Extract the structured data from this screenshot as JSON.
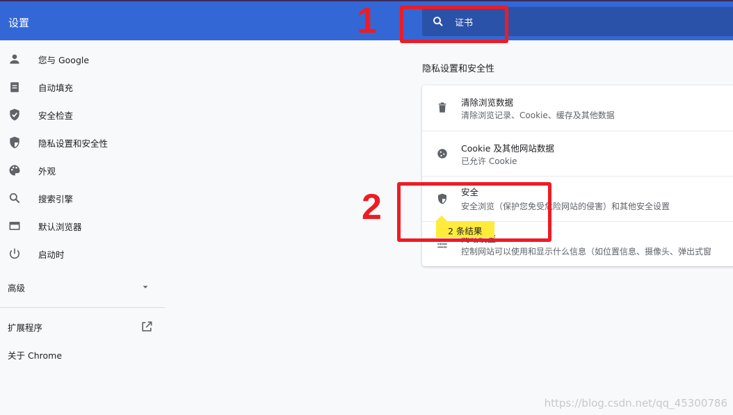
{
  "header": {
    "title": "设置",
    "search_value": "证书"
  },
  "sidebar": {
    "items": [
      {
        "label": "您与 Google",
        "icon": "person-icon"
      },
      {
        "label": "自动填充",
        "icon": "clipboard-icon"
      },
      {
        "label": "安全检查",
        "icon": "shield-check-icon"
      },
      {
        "label": "隐私设置和安全性",
        "icon": "shield-icon"
      },
      {
        "label": "外观",
        "icon": "palette-icon"
      },
      {
        "label": "搜索引擎",
        "icon": "search-icon"
      },
      {
        "label": "默认浏览器",
        "icon": "browser-icon"
      },
      {
        "label": "启动时",
        "icon": "power-icon"
      }
    ],
    "advanced": "高级",
    "extensions": "扩展程序",
    "about": "关于 Chrome"
  },
  "main": {
    "section_title": "隐私设置和安全性",
    "rows": [
      {
        "title": "清除浏览数据",
        "subtitle": "清除浏览记录、Cookie、缓存及其他数据",
        "icon": "trash-icon"
      },
      {
        "title": "Cookie 及其他网站数据",
        "subtitle": "已允许 Cookie",
        "icon": "cookie-icon"
      },
      {
        "title": "安全",
        "subtitle": "安全浏览（保护您免受危险网站的侵害）和其他安全设置",
        "icon": "shield-icon"
      },
      {
        "title": "网站设置",
        "subtitle": "控制网站可以使用和显示什么信息（如位置信息、摄像头、弹出式窗",
        "icon": "tune-icon"
      }
    ],
    "result_bubble": "2 条结果"
  },
  "annotations": {
    "label1": "1",
    "label2": "2",
    "color": "#ed1c24"
  },
  "watermark": "https://blog.csdn.net/qq_45300786"
}
